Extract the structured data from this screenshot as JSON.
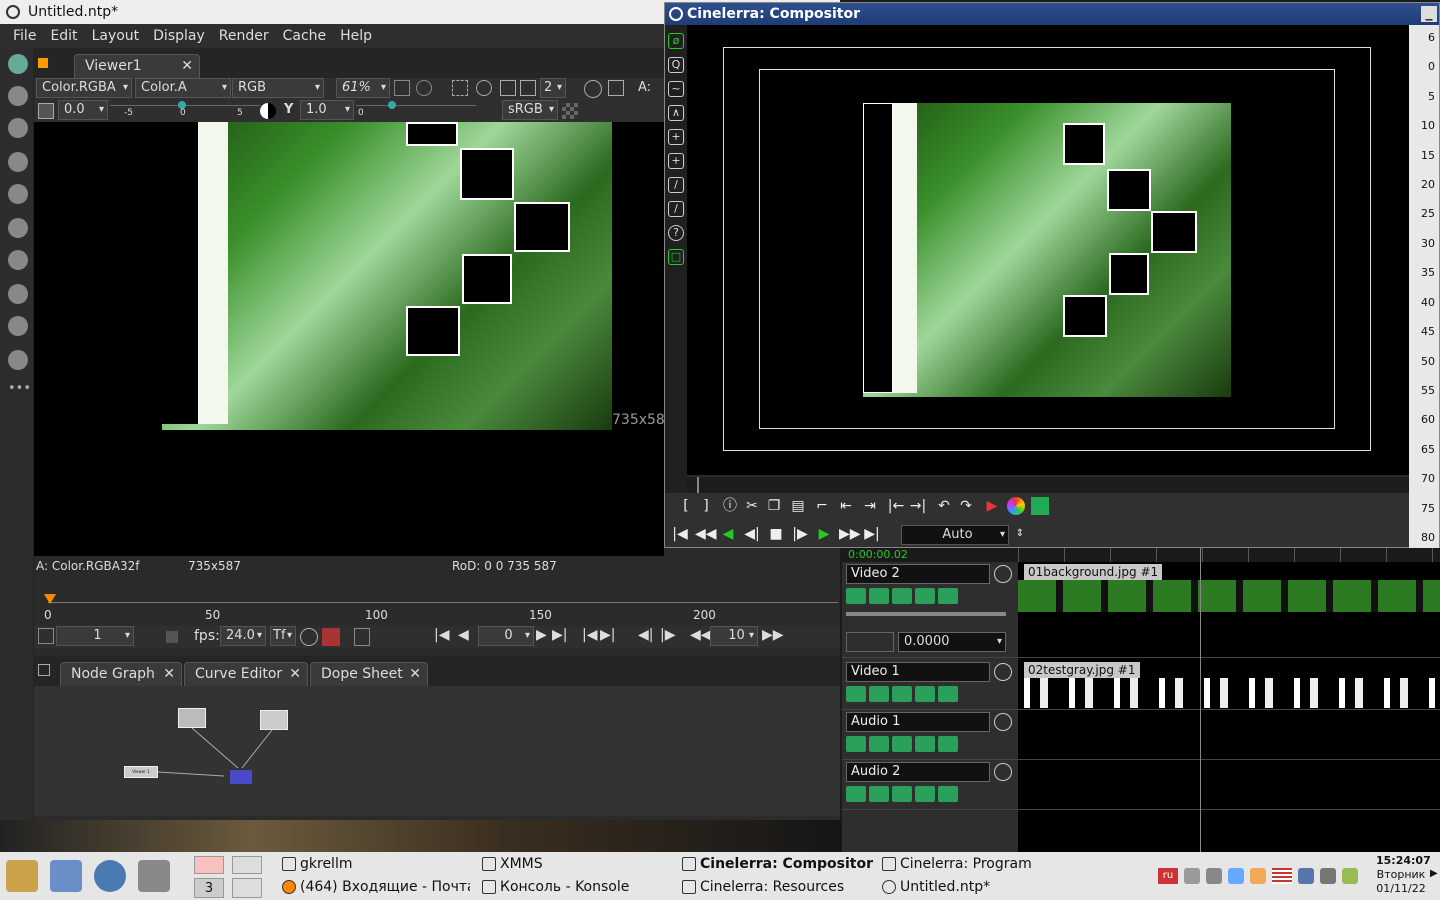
{
  "natron": {
    "title": "Untitled.ntp*",
    "menu": [
      "File",
      "Edit",
      "Layout",
      "Display",
      "Render",
      "Cache",
      "Help"
    ],
    "viewer_tab": "Viewer1",
    "layer": "Color.RGBA",
    "alpha": "Color.A",
    "channels": "RGB",
    "zoom": "61%",
    "proxy": "2",
    "a_label": "A:",
    "gain": "0.0",
    "gamma_label": "Y",
    "gamma": "1.0",
    "colorspace": "sRGB",
    "gain_ticks": [
      "-5",
      "0",
      "5"
    ],
    "gamma_ticks": [
      "0"
    ],
    "size_overlay": "735x58",
    "info": {
      "format": "A: Color.RGBA32f",
      "size": "735x587",
      "rod": "RoD: 0 0 735 587"
    },
    "timeline_ticks": [
      "0",
      "50",
      "100",
      "150",
      "200"
    ],
    "frame_start": "1",
    "fps_label": "fps:",
    "fps": "24.0",
    "tf_label": "Tf",
    "current_frame": "0",
    "frame_increment": "10",
    "node_tabs": [
      "Node Graph",
      "Curve Editor",
      "Dope Sheet"
    ],
    "node_label": "Viewer 1"
  },
  "compositor": {
    "title": "Cinelerra: Compositor",
    "scale": [
      "6",
      "0",
      "5",
      "10",
      "15",
      "20",
      "25",
      "30",
      "35",
      "40",
      "45",
      "50",
      "55",
      "60",
      "65",
      "70",
      "75",
      "80"
    ],
    "zoom": "Auto"
  },
  "tracks": {
    "items": [
      {
        "name": "Video 2",
        "clip": "01background.jpg #1"
      },
      {
        "name": "Video 1",
        "clip": "02testgray.jpg #1"
      },
      {
        "name": "Audio 1"
      },
      {
        "name": "Audio 2"
      }
    ],
    "fade_value": "0.0000",
    "time_header": "0:00:00.02"
  },
  "taskbar": {
    "desktop_number": "3",
    "windows": [
      {
        "label": "gkrellm"
      },
      {
        "label": "XMMS"
      },
      {
        "label": "Cinelerra: Compositor",
        "active": true
      },
      {
        "label": "Cinelerra: Program"
      },
      {
        "label": "(464) Входящие - Почта I"
      },
      {
        "label": "Консоль - Konsole"
      },
      {
        "label": "Cinelerra: Resources"
      },
      {
        "label": "Untitled.ntp*"
      }
    ],
    "lang": "ru",
    "clock": {
      "time": "15:24:07",
      "day": "Вторник",
      "date": "01/11/22"
    }
  }
}
